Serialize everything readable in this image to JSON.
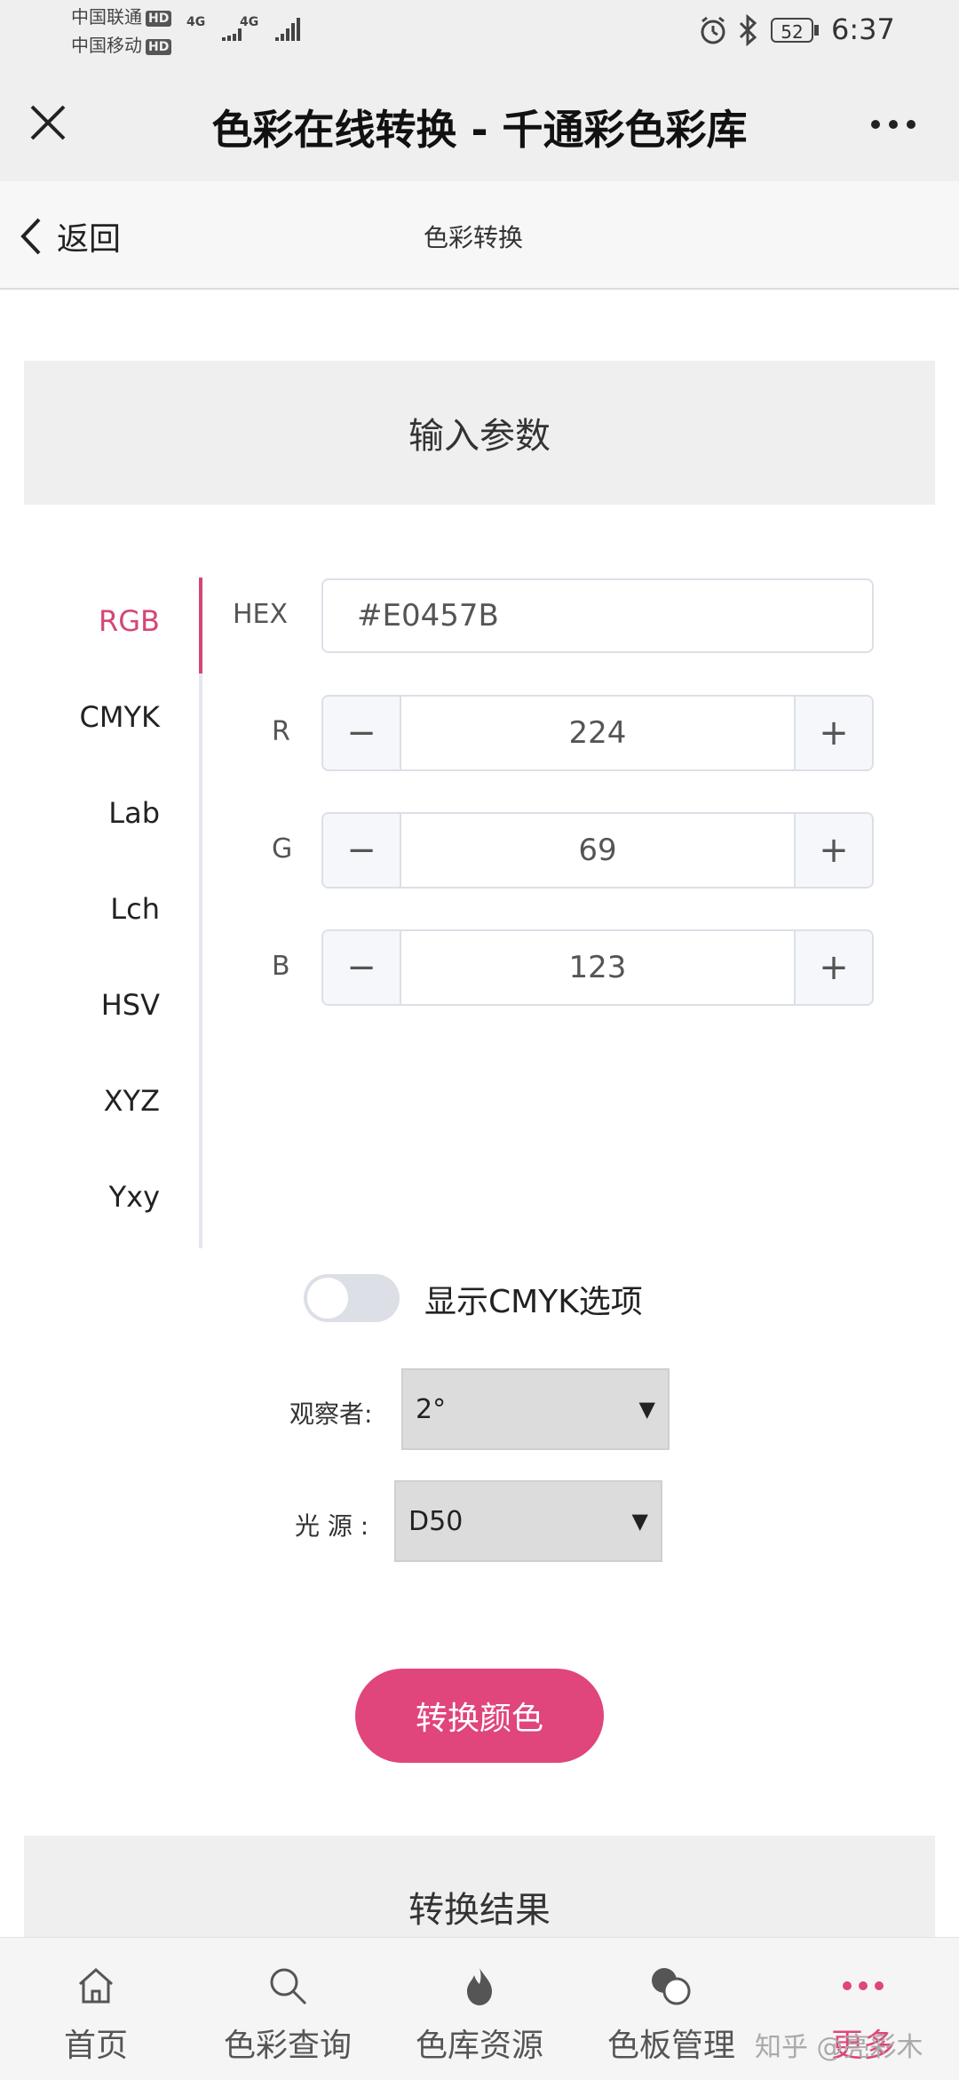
{
  "status": {
    "carrier1": "中国联通",
    "carrier2": "中国移动",
    "hd": "HD",
    "net": "4G",
    "battery": "52",
    "time": "6:37"
  },
  "header": {
    "title": "色彩在线转换 - 千通彩色彩库"
  },
  "nav": {
    "back_label": "返回",
    "title": "色彩转换"
  },
  "input_section": {
    "title": "输入参数"
  },
  "tabs": [
    {
      "label": "RGB",
      "active": true
    },
    {
      "label": "CMYK",
      "active": false
    },
    {
      "label": "Lab",
      "active": false
    },
    {
      "label": "Lch",
      "active": false
    },
    {
      "label": "HSV",
      "active": false
    },
    {
      "label": "XYZ",
      "active": false
    },
    {
      "label": "Yxy",
      "active": false
    }
  ],
  "fields": {
    "hex_label": "HEX",
    "hex_value": "#E0457B",
    "r_label": "R",
    "r_value": "224",
    "g_label": "G",
    "g_value": "69",
    "b_label": "B",
    "b_value": "123",
    "minus": "−",
    "plus": "+"
  },
  "cmyk_toggle": {
    "label": "显示CMYK选项",
    "on": false
  },
  "observer": {
    "label": "观察者:",
    "value": "2°"
  },
  "illuminant": {
    "label": "光 源 :",
    "value": "D50"
  },
  "convert_button": {
    "label": "转换颜色"
  },
  "result_section": {
    "title": "转换结果"
  },
  "bottom_tabs": [
    {
      "label": "首页",
      "icon": "home-icon",
      "active": false
    },
    {
      "label": "色彩查询",
      "icon": "search-icon",
      "active": false
    },
    {
      "label": "色库资源",
      "icon": "flame-icon",
      "active": false
    },
    {
      "label": "色板管理",
      "icon": "palette-icon",
      "active": false
    },
    {
      "label": "更多",
      "icon": "more-dots-icon",
      "active": true
    }
  ],
  "watermark": "知乎 @亮彩木",
  "colors": {
    "accent": "#e0457b",
    "active_tab": "#d54678",
    "header_bg": "#efefef"
  }
}
